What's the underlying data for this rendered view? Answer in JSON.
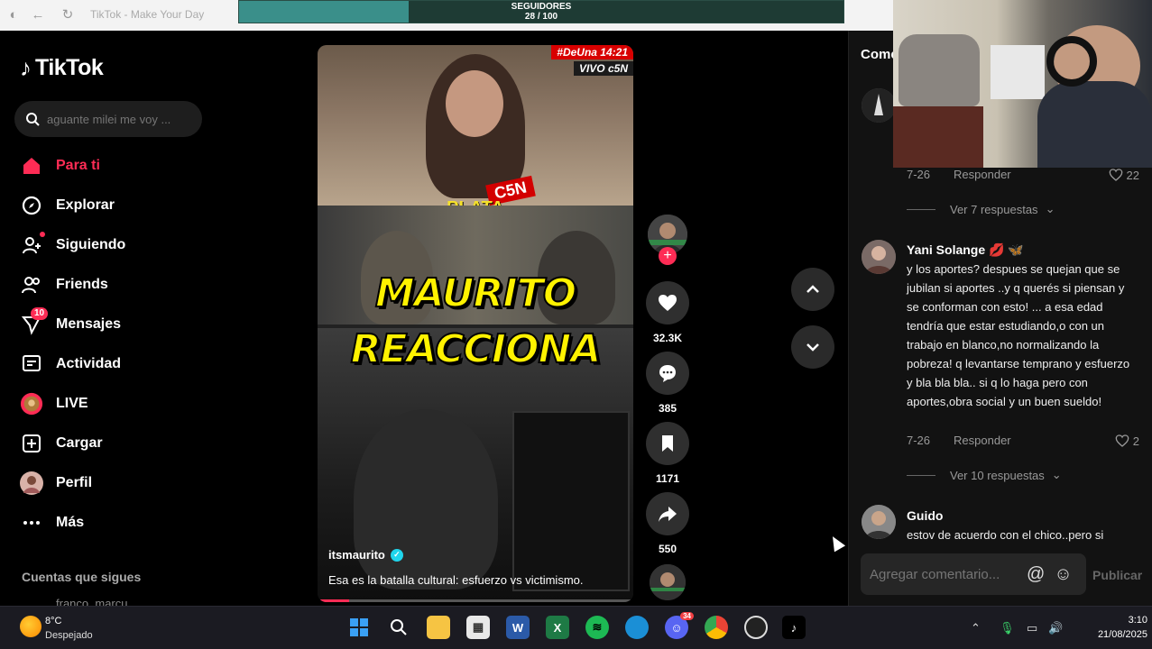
{
  "browser": {
    "tab_title": "TikTok - Make Your Day",
    "followers_label": "SEGUIDORES",
    "followers_count": "28 / 100",
    "followers_progress": 0.28
  },
  "sidebar": {
    "logo_text": "TikTok",
    "search_placeholder": "aguante milei me voy ...",
    "items": [
      {
        "label": "Para ti",
        "icon": "home-icon",
        "active": true
      },
      {
        "label": "Explorar",
        "icon": "compass-icon"
      },
      {
        "label": "Siguiendo",
        "icon": "following-icon"
      },
      {
        "label": "Friends",
        "icon": "friends-icon"
      },
      {
        "label": "Mensajes",
        "icon": "messages-icon",
        "badge": "10"
      },
      {
        "label": "Actividad",
        "icon": "activity-icon"
      },
      {
        "label": "LIVE",
        "icon": "live-icon"
      },
      {
        "label": "Cargar",
        "icon": "upload-icon"
      },
      {
        "label": "Perfil",
        "icon": "profile-avatar"
      },
      {
        "label": "Más",
        "icon": "more-icon"
      }
    ],
    "following_title": "Cuentas que sigues",
    "following_first": "franco_marcu"
  },
  "video": {
    "news_tag": "#DeUna 14:21",
    "news_live": "VIVO c5N",
    "c5n_logo": "C5N",
    "plata_text": "PLATA",
    "title_line1": "MAURITO",
    "title_line2": "REACCIONA",
    "username": "itsmaurito",
    "caption": "Esa es la batalla cultural: esfuerzo vs victimismo.",
    "progress": 0.1
  },
  "actions": {
    "likes": "32.3K",
    "comments": "385",
    "saves": "1171",
    "shares": "550"
  },
  "comments": {
    "title": "Come",
    "c1": {
      "date": "7-26",
      "reply": "Responder",
      "likes": "22",
      "view_replies": "Ver 7 respuestas"
    },
    "c2": {
      "name": "Yani Solange",
      "text": "y los aportes? despues se quejan que se jubilan si aportes ..y q querés si piensan y se conforman con esto! ... a esa edad tendría que estar estudiando,o con un trabajo en blanco,no normalizando la pobreza! q levantarse temprano y esfuerzo y bla bla bla.. si q lo haga pero con aportes,obra social y un buen sueldo!",
      "date": "7-26",
      "reply": "Responder",
      "likes": "2",
      "view_replies": "Ver 10 respuestas"
    },
    "c3": {
      "name": "Guido",
      "text": "estov de acuerdo con el chico..pero si"
    },
    "add_placeholder": "Agregar comentario...",
    "publish": "Publicar"
  },
  "taskbar": {
    "weather_temp": "8°C",
    "weather_desc": "Despejado",
    "time": "3:10",
    "date": "21/08/2025",
    "discord_badge": "34"
  },
  "colors": {
    "accent": "#fe2c55",
    "progress_teal": "#3a8f8a",
    "title_yellow": "#fff200"
  }
}
